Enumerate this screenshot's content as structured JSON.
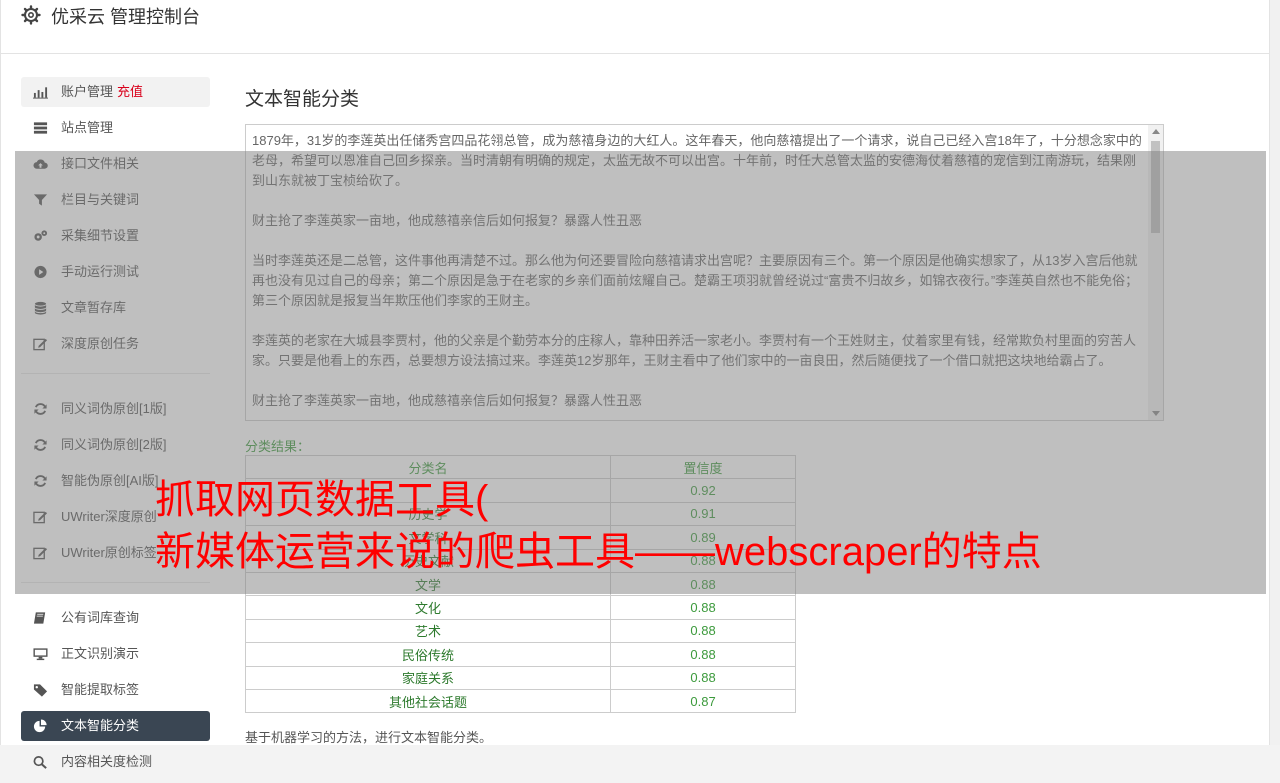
{
  "header": {
    "title": "优采云 管理控制台",
    "icon": "gear-icon"
  },
  "sidebar": {
    "group1": [
      {
        "label": "账户管理",
        "tag": "充值",
        "icon": "bar-chart-icon"
      },
      {
        "label": "站点管理",
        "icon": "server-icon"
      },
      {
        "label": "接口文件相关",
        "icon": "cloud-upload-icon"
      },
      {
        "label": "栏目与关键词",
        "icon": "filter-icon"
      },
      {
        "label": "采集细节设置",
        "icon": "gears-icon"
      },
      {
        "label": "手动运行测试",
        "icon": "play-circle-icon"
      },
      {
        "label": "文章暂存库",
        "icon": "database-icon"
      },
      {
        "label": "深度原创任务",
        "icon": "edit-icon"
      }
    ],
    "group2": [
      {
        "label": "同义词伪原创[1版]",
        "icon": "refresh-icon"
      },
      {
        "label": "同义词伪原创[2版]",
        "icon": "refresh-icon"
      },
      {
        "label": "智能伪原创[AI版]",
        "icon": "refresh-icon"
      },
      {
        "label": "UWriter深度原创",
        "icon": "edit-icon"
      },
      {
        "label": "UWriter原创标签",
        "icon": "edit-icon"
      }
    ],
    "group3": [
      {
        "label": "公有词库查询",
        "icon": "book-icon"
      },
      {
        "label": "正文识别演示",
        "icon": "desktop-icon"
      },
      {
        "label": "智能提取标签",
        "icon": "tag-icon"
      },
      {
        "label": "文本智能分类",
        "icon": "pie-chart-icon",
        "active": true
      },
      {
        "label": "内容相关度检测",
        "icon": "search-icon"
      }
    ]
  },
  "main": {
    "title": "文本智能分类",
    "article": [
      "1879年，31岁的李莲英出任储秀宫四品花翎总管，成为慈禧身边的大红人。这年春天，他向慈禧提出了一个请求，说自己已经入宫18年了，十分想念家中的老母，希望可以恩准自己回乡探亲。当时清朝有明确的规定，太监无故不可以出宫。十年前，时任大总管太监的安德海仗着慈禧的宠信到江南游玩，结果刚到山东就被丁宝桢给砍了。",
      "财主抢了李莲英家一亩地，他成慈禧亲信后如何报复？暴露人性丑恶",
      "当时李莲英还是二总管，这件事他再清楚不过。那么他为何还要冒险向慈禧请求出宫呢？主要原因有三个。第一个原因是他确实想家了，从13岁入宫后他就再也没有见过自己的母亲；第二个原因是急于在老家的乡亲们面前炫耀自己。楚霸王项羽就曾经说过“富贵不归故乡，如锦衣夜行。”李莲英自然也不能免俗；第三个原因就是报复当年欺压他们李家的王财主。",
      "李莲英的老家在大城县李贾村，他的父亲是个勤劳本分的庄稼人，靠种田养活一家老小。李贾村有一个王姓财主，仗着家里有钱，经常欺负村里面的穷苦人家。只要是他看上的东西，总要想方设法搞过来。李莲英12岁那年，王财主看中了他们家中的一亩良田，然后随便找了一个借口就把这块地给霸占了。",
      "财主抢了李莲英家一亩地，他成慈禧亲信后如何报复？暴露人性丑恶"
    ],
    "result_label": "分类结果：",
    "table": {
      "headers": [
        "分类名",
        "置信度"
      ],
      "rows": [
        [
          "",
          "0.92"
        ],
        [
          "历史学",
          "0.91"
        ],
        [
          "文学科",
          "0.89"
        ],
        [
          "历史文献",
          "0.88"
        ],
        [
          "文学",
          "0.88"
        ],
        [
          "文化",
          "0.88"
        ],
        [
          "艺术",
          "0.88"
        ],
        [
          "民俗传统",
          "0.88"
        ],
        [
          "家庭关系",
          "0.88"
        ],
        [
          "其他社会话题",
          "0.87"
        ]
      ]
    },
    "note": "基于机器学习的方法，进行文本智能分类。"
  },
  "overlay": {
    "line1": "抓取网页数据工具(",
    "line2": "新媒体运营来说的爬虫工具——webscraper的特点",
    "color": "#ff0000"
  }
}
